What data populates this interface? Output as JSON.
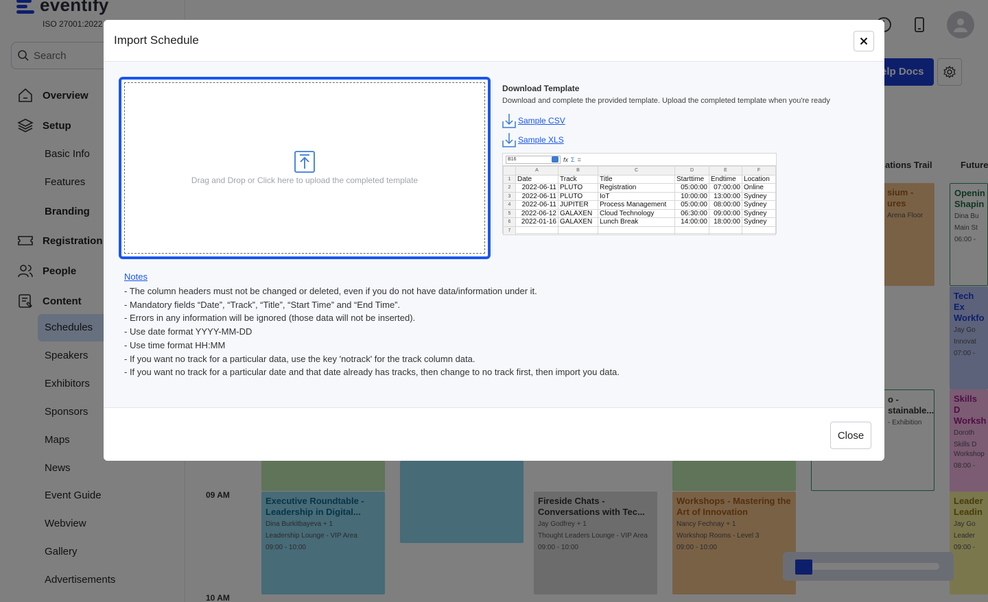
{
  "app": {
    "brand": "eventify",
    "brand_sub": "ISO 27001:2022",
    "search_placeholder": "Search",
    "colors": {
      "brand": "#1a3fd6",
      "accent": "#1a56f0",
      "active_bg": "#cfe0ff"
    }
  },
  "sidebar": {
    "main_items": [
      {
        "label": "Overview",
        "icon": "home-icon"
      },
      {
        "label": "Setup",
        "icon": "layers-icon"
      },
      {
        "label": "Registration",
        "icon": "ticket-icon"
      },
      {
        "label": "People",
        "icon": "people-icon"
      },
      {
        "label": "Content",
        "icon": "content-icon"
      }
    ],
    "setup_children": [
      "Basic Info",
      "Features",
      "Branding"
    ],
    "content_children": [
      "Schedules",
      "Speakers",
      "Exhibitors",
      "Sponsors",
      "Maps",
      "News",
      "Event Guide",
      "Webview",
      "Gallery",
      "Advertisements"
    ]
  },
  "topbar": {
    "help_label": "elp Docs"
  },
  "schedule_bg": {
    "col_heads": [
      "ations Trail",
      "Future"
    ],
    "time_labels": [
      "09 AM",
      "10 AM"
    ],
    "cards": [
      {
        "title": "sium - ures",
        "meta": "Arena Floor"
      },
      {
        "title": "Openin Shapin",
        "meta1": "Dina Bu",
        "meta2": "Main St",
        "meta3": "06:00 -"
      },
      {
        "title": "Tech Ex Workfo",
        "meta1": "Jay Go",
        "meta2": "Innovat",
        "meta3": "07:00 -"
      },
      {
        "title": "o - stainable...",
        "meta": "- Exhibition"
      },
      {
        "title": "Skills D Worksh",
        "meta1": "Doroth",
        "meta2": "Skills D Workshop",
        "meta3": "08:00 -"
      },
      {
        "title": "Executive Roundtable - Leadership in Digital...",
        "meta1": "Dina Burkitbayeva + 1",
        "meta2": "Leadership Lounge - VIP Area",
        "meta3": "09:00 - 10:00"
      },
      {
        "title": "Fireside Chats - Conversations with Tec...",
        "meta1": "Jay Godfrey + 1",
        "meta2": "Thought Leaders Lounge - VIP Area",
        "meta3": "09:00 - 10:00"
      },
      {
        "title": "Workshops - Mastering the Art of Innovation",
        "meta1": "Nancy Fechnay + 1",
        "meta2": "Workshop Rooms - Level 3",
        "meta3": "09:00 - 10:00"
      },
      {
        "title": "Leader Leadin",
        "meta1": "Jay Go",
        "meta2": "Leader",
        "meta3": "09:00 -"
      }
    ],
    "progress": 0.12
  },
  "modal": {
    "title": "Import Schedule",
    "dropzone_text": "Drag and Drop or Click here to upload the completed template",
    "template_title": "Download Template",
    "template_desc": "Download and complete the provided template. Upload the completed template when you're ready",
    "links": [
      "Sample CSV",
      "Sample XLS"
    ],
    "sheet": {
      "cell_ref": "B16",
      "formula_symbols": [
        "fx",
        "Σ",
        "="
      ],
      "col_letters": [
        "A",
        "B",
        "C",
        "D",
        "E",
        "F"
      ],
      "rows": [
        [
          "Date",
          "Track",
          "Title",
          "Starttime",
          "Endtime",
          "Location"
        ],
        [
          "2022-06-11",
          "PLUTO",
          "Registration",
          "05:00:00",
          "07:00:00",
          "Online"
        ],
        [
          "2022-06-11",
          "PLUTO",
          "IoT",
          "10:00:00",
          "13:00:00",
          "Sydney"
        ],
        [
          "2022-06-11",
          "JUPITER",
          "Process Management",
          "05:00:00",
          "08:00:00",
          "Sydney"
        ],
        [
          "2022-06-12",
          "GALAXEN",
          "Cloud Technology",
          "06:30:00",
          "09:00:00",
          "Sydney"
        ],
        [
          "2022-01-16",
          "GALAXEN",
          "Lunch Break",
          "14:00:00",
          "18:00:00",
          "Sydney"
        ],
        [
          "",
          "",
          "",
          "",
          "",
          ""
        ]
      ]
    },
    "notes_title": "Notes",
    "notes": [
      "- The column headers must not be changed or deleted, even if you do not have data/information under it.",
      "- Mandatory fields “Date”, “Track”, “Title”, “Start Time” and “End Time”.",
      "- Errors in any information will be ignored (those data will not be inserted).",
      "- Use date format YYYY-MM-DD",
      "- Use time format HH:MM",
      "- If you want no track for a particular data, use the key 'notrack' for the track column data.",
      "- If you want no track for a particular date and that date already has tracks, then change to no track first, then import you data."
    ],
    "close_label": "Close"
  }
}
